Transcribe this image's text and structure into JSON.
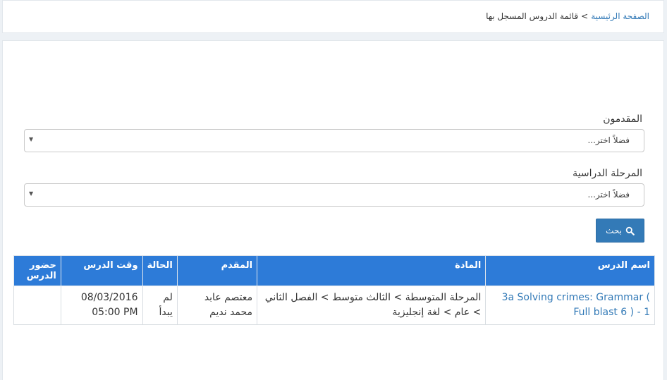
{
  "breadcrumb": {
    "home": "الصفحة الرئيسية",
    "separator": ">",
    "current": "قائمة الدروس المسجل بها"
  },
  "filters": {
    "presenters_label": "المقدمون",
    "presenters_placeholder": "فضلاً اختر...",
    "stage_label": "المرحلة الدراسية",
    "stage_placeholder": "فضلاً اختر..."
  },
  "search_button": {
    "label": "بحث",
    "icon": "search-icon"
  },
  "table": {
    "headers": {
      "lesson_name": "اسم الدرس",
      "subject": "المادة",
      "presenter": "المقدم",
      "status": "الحالة",
      "lesson_time": "وقت الدرس",
      "attendance": "حضور الدرس"
    },
    "rows": [
      {
        "lesson_name": "3a Solving crimes: Grammar ( Full blast 6 ) - 1",
        "subject": "المرحلة المتوسطة > الثالث متوسط > الفصل الثاني > عام > لغة إنجليزية",
        "presenter": "معتصم عابد محمد نديم",
        "status": "لم يبدأ",
        "lesson_time": "08/03/2016 05:00 PM",
        "attendance": ""
      }
    ]
  },
  "colors": {
    "primary": "#337ab7",
    "table_header": "#2d7bd8",
    "background": "#edf1f5"
  }
}
